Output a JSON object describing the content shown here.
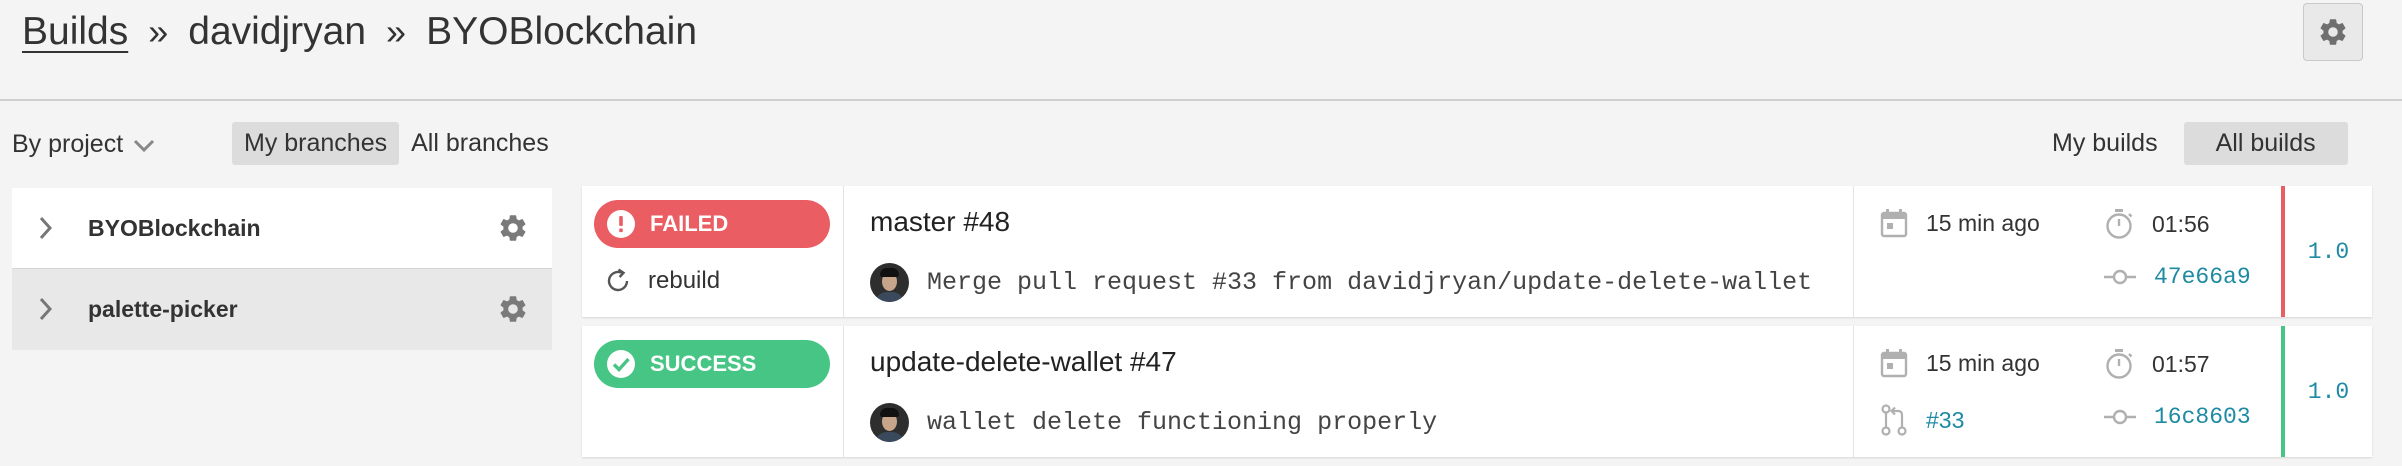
{
  "breadcrumb": {
    "root": "Builds",
    "separator": "»",
    "owner": "davidjryan",
    "repo": "BYOBlockchain"
  },
  "toolbar": {
    "group_by": "By project",
    "branch_tabs": [
      "My branches",
      "All branches"
    ],
    "active_branch_tab": "My branches",
    "build_tabs": [
      "My builds",
      "All builds"
    ],
    "active_build_tab": "All builds"
  },
  "sidebar": {
    "projects": [
      {
        "name": "BYOBlockchain",
        "selected": false
      },
      {
        "name": "palette-picker",
        "selected": true
      }
    ]
  },
  "builds": [
    {
      "status": "FAILED",
      "status_icon": "exclamation-icon",
      "action": "rebuild",
      "title": "master #48",
      "commit_message": "Merge pull request #33 from davidjryan/update-delete-wallet",
      "time_ago": "15 min ago",
      "duration": "01:56",
      "pr": "",
      "commit_hash": "47e66a9",
      "version": "1.0"
    },
    {
      "status": "SUCCESS",
      "status_icon": "check-icon",
      "action": "",
      "title": "update-delete-wallet #47",
      "commit_message": "wallet delete functioning properly",
      "time_ago": "15 min ago",
      "duration": "01:57",
      "pr": "#33",
      "commit_hash": "16c8603",
      "version": "1.0"
    }
  ],
  "colors": {
    "failed": "#ea5d63",
    "success": "#47c585",
    "link": "#1f8aa3"
  }
}
